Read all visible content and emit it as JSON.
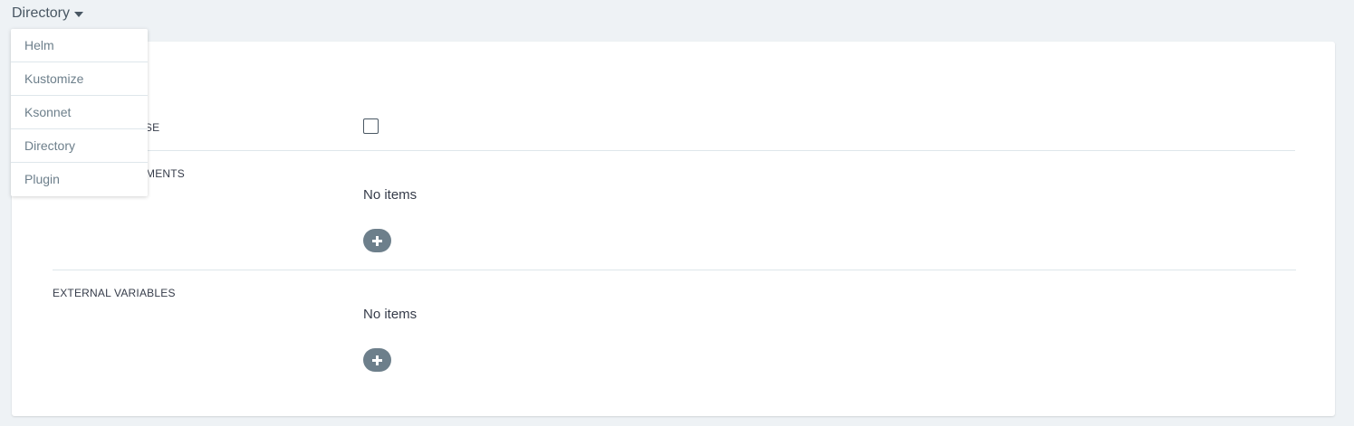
{
  "source_type": {
    "selected": "Directory"
  },
  "dropdown": {
    "items": [
      {
        "label": "Helm"
      },
      {
        "label": "Kustomize"
      },
      {
        "label": "Ksonnet"
      },
      {
        "label": "Directory"
      },
      {
        "label": "Plugin"
      }
    ]
  },
  "panel": {
    "directory_recurse_label": "RSE",
    "top_level_arguments_label": "MENTS",
    "top_level_arguments_empty": "No items",
    "external_variables_label": "EXTERNAL VARIABLES",
    "external_variables_empty": "No items"
  }
}
